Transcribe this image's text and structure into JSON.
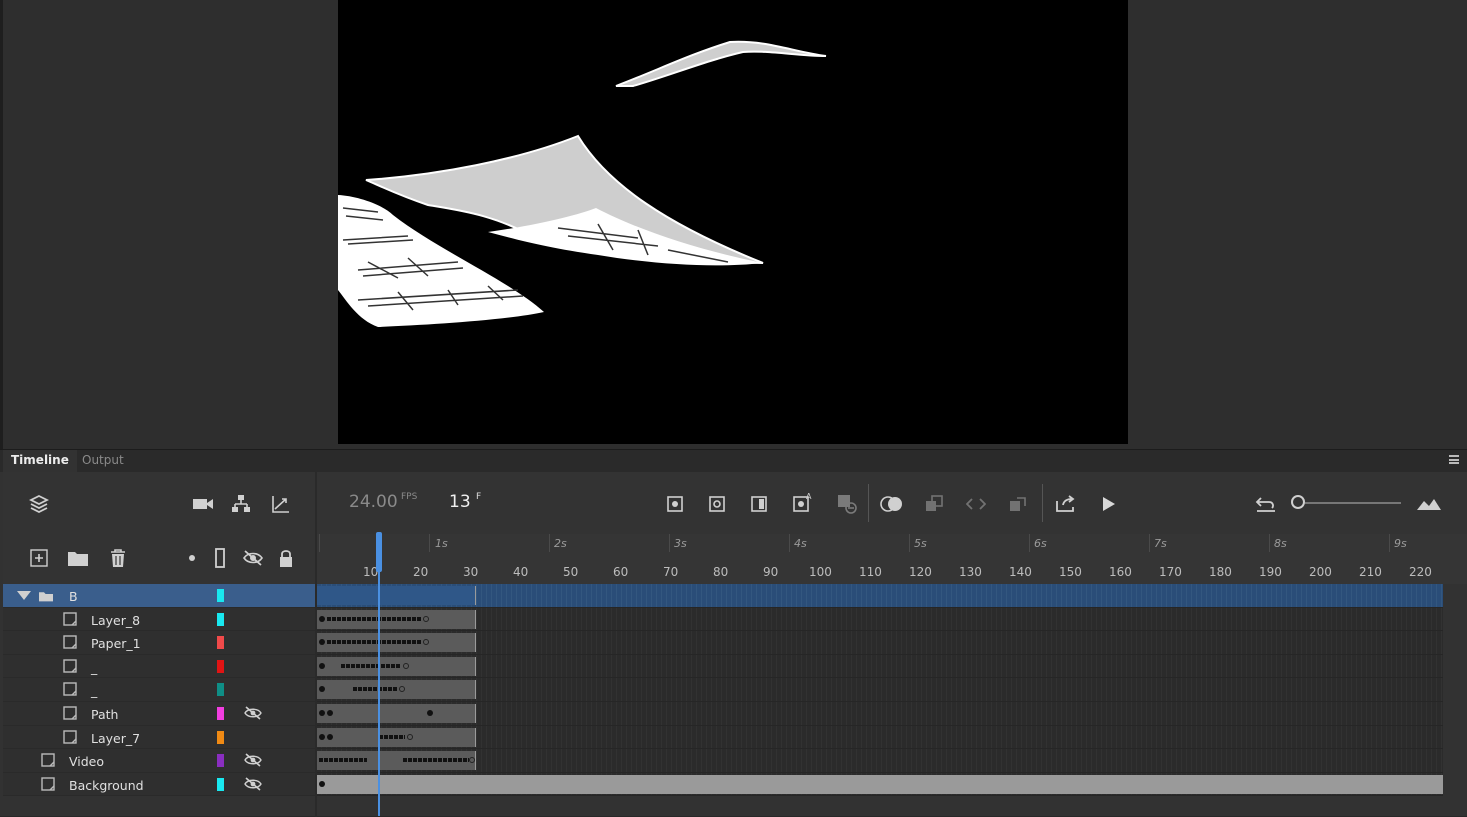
{
  "tabs": {
    "timeline": "Timeline",
    "output": "Output"
  },
  "playback": {
    "fps": "24.00",
    "fps_unit": "FPS",
    "current_frame": "13",
    "frame_unit": "F"
  },
  "ruler": {
    "seconds": [
      "1s",
      "2s",
      "3s",
      "4s",
      "5s",
      "6s",
      "7s",
      "8s",
      "9s"
    ],
    "frames": [
      "10",
      "20",
      "30",
      "40",
      "50",
      "60",
      "70",
      "80",
      "90",
      "100",
      "110",
      "120",
      "130",
      "140",
      "150",
      "160",
      "170",
      "180",
      "190",
      "200",
      "210",
      "220"
    ]
  },
  "layers": [
    {
      "name": "B",
      "type": "folder",
      "color": "#19e8f0",
      "hidden": false,
      "selected": true
    },
    {
      "name": "Layer_8",
      "type": "layer",
      "color": "#19e8f0",
      "hidden": false
    },
    {
      "name": "Paper_1",
      "type": "layer",
      "color": "#f04a4a",
      "hidden": false
    },
    {
      "name": "_",
      "type": "layer",
      "color": "#e01414",
      "hidden": false
    },
    {
      "name": "_",
      "type": "layer",
      "color": "#0f8e86",
      "hidden": false
    },
    {
      "name": "Path",
      "type": "layer",
      "color": "#f23ee0",
      "hidden": true
    },
    {
      "name": "Layer_7",
      "type": "layer",
      "color": "#f08a14",
      "hidden": false
    },
    {
      "name": "Video",
      "type": "layer",
      "color": "#8a2ec0",
      "hidden": true
    },
    {
      "name": "Background",
      "type": "layer",
      "color": "#19e8f0",
      "hidden": true
    }
  ],
  "icons": {
    "toolbar_left": [
      "layers-icon",
      "camera-icon",
      "hierarchy-icon",
      "graph-icon"
    ],
    "layer_tools": [
      "new-layer-icon",
      "new-folder-icon",
      "delete-icon",
      "dot-icon",
      "outline-icon",
      "hide-all-icon",
      "lock-all-icon"
    ],
    "center": [
      "insert-keyframe-icon",
      "blank-keyframe-icon",
      "insert-frame-icon",
      "auto-keyframe-icon",
      "remove-frame-icon",
      "onion-skin-icon",
      "edit-multiple-icon",
      "loop-icon",
      "sync-icon",
      "export-icon",
      "play-icon"
    ],
    "right": [
      "undo-icon",
      "zoom-slider",
      "fit-icon"
    ]
  }
}
